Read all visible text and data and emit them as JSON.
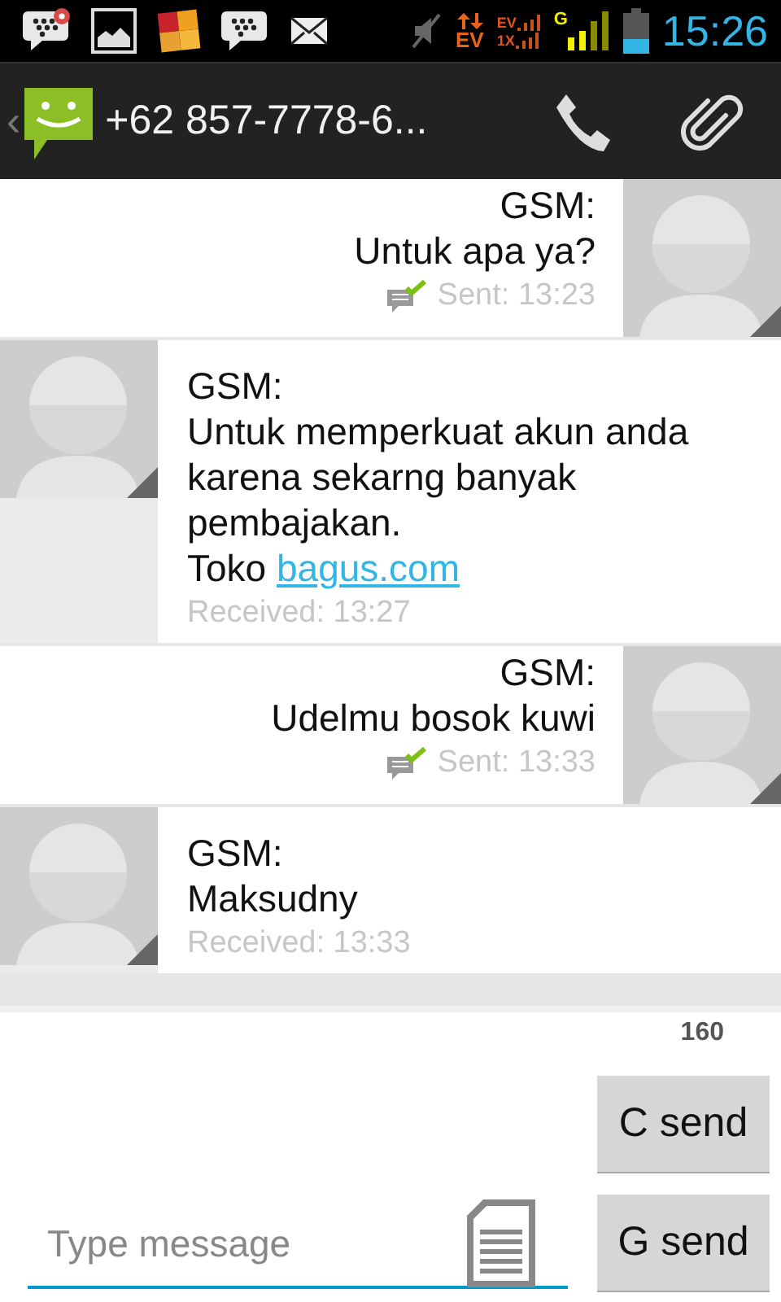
{
  "status_bar": {
    "notifications": [
      {
        "kind": "chat",
        "badge": true
      },
      {
        "kind": "gallery",
        "badge": false
      },
      {
        "kind": "tiles",
        "badge": false
      },
      {
        "kind": "chat",
        "badge": false
      },
      {
        "kind": "mail",
        "badge": false
      }
    ],
    "data_label": "EV",
    "signal_labels": [
      "EV",
      "1X"
    ],
    "gsm_label": "G",
    "time": "15:26"
  },
  "header": {
    "back": "‹",
    "title": "+62 857-7778-6..."
  },
  "messages": [
    {
      "kind": "sent",
      "sender": "GSM:",
      "lines": [
        {
          "text": "Untuk apa ya?"
        }
      ],
      "status": "Sent: 13:23"
    },
    {
      "kind": "received",
      "sender": "GSM:",
      "lines": [
        {
          "text": "Untuk memperkuat akun anda karena sekarng banyak pembajakan."
        },
        {
          "text": "Toko ",
          "link": "bagus.com"
        }
      ],
      "status": "Received: 13:27"
    },
    {
      "kind": "sent",
      "sender": "GSM:",
      "lines": [
        {
          "text": "Udelmu bosok kuwi"
        }
      ],
      "status": "Sent: 13:33"
    },
    {
      "kind": "received",
      "sender": "GSM:",
      "lines": [
        {
          "text": "Maksudny"
        }
      ],
      "status": "Received: 13:33"
    }
  ],
  "composer": {
    "counter": "160",
    "placeholder": "Type message",
    "buttons": [
      "C send",
      "G send"
    ]
  }
}
